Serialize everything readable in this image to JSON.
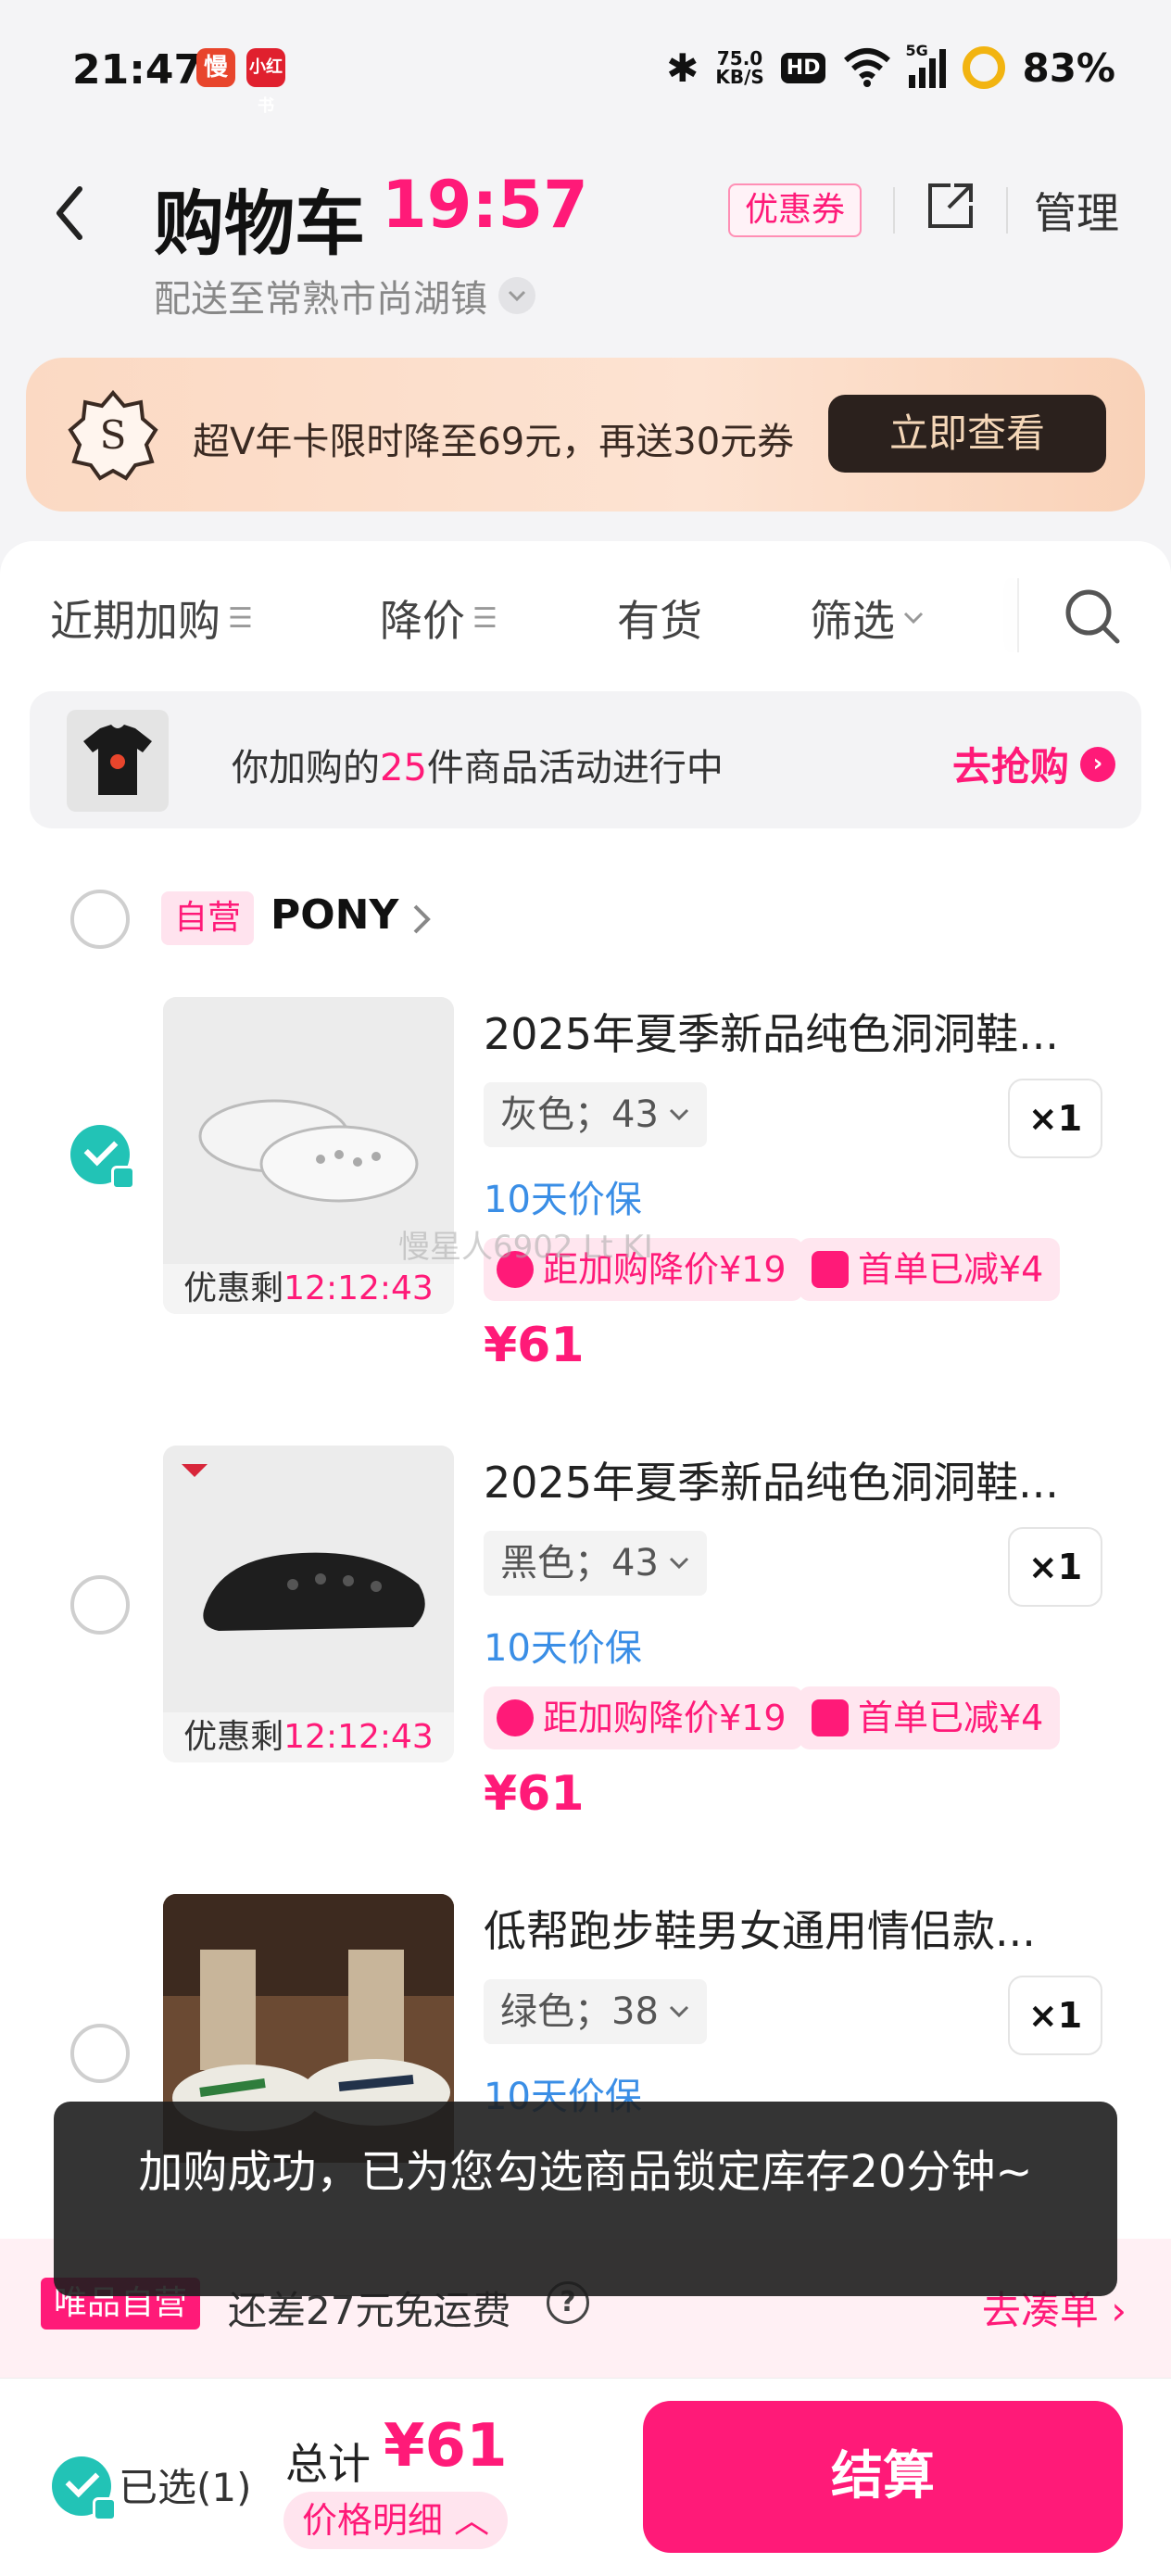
{
  "status_bar": {
    "time": "21:47",
    "app_icon_1": "慢",
    "app_icon_2": "小红书",
    "net_speed_value": "75.0",
    "net_speed_unit": "KB/S",
    "hd": "HD",
    "signal": "5G",
    "battery": "83%"
  },
  "header": {
    "title": "购物车",
    "timer": "19:57",
    "address": "配送至常熟市尚湖镇",
    "coupon_label": "优惠券",
    "manage_label": "管理"
  },
  "promo": {
    "badge_letter": "S",
    "text": "超V年卡限时降至69元，再送30元券",
    "button": "立即查看"
  },
  "filters": {
    "recent": "近期加购",
    "price_drop": "降价",
    "in_stock": "有货",
    "filter": "筛选"
  },
  "activity": {
    "text_prefix": "你加购的",
    "count": "25",
    "text_suffix": "件商品活动进行中",
    "link": "去抢购"
  },
  "store": {
    "tag": "自营",
    "name": "PONY"
  },
  "items": [
    {
      "title": "2025年夏季新品纯色洞洞鞋...",
      "variant": "灰色；43",
      "qty": "×1",
      "warranty": "10天价保",
      "tag1": "距加购降价¥19",
      "tag2": "首单已减¥4",
      "price": "¥61",
      "countdown_label": "优惠剩",
      "countdown": "12:12:43",
      "checked": true,
      "colors": {
        "shoe": "#f2f2f2"
      }
    },
    {
      "title": "2025年夏季新品纯色洞洞鞋...",
      "variant": "黑色；43",
      "qty": "×1",
      "warranty": "10天价保",
      "tag1": "距加购降价¥19",
      "tag2": "首单已减¥4",
      "price": "¥61",
      "countdown_label": "优惠剩",
      "countdown": "12:12:43",
      "checked": false,
      "colors": {
        "shoe": "#1e1e1e"
      }
    },
    {
      "title": "低帮跑步鞋男女通用情侣款...",
      "variant": "绿色；38",
      "qty": "×1",
      "warranty": "10天价保",
      "checked": false
    }
  ],
  "watermark": "慢星人6902 Lt KI",
  "shipping": {
    "tag": "唯品自营",
    "text": "还差27元免运费",
    "help": "?",
    "link": "去凑单"
  },
  "toast": "加购成功，已为您勾选商品锁定库存20分钟~",
  "bottom": {
    "selected": "已选(1)",
    "total_label": "总计",
    "total": "¥61",
    "detail": "价格明细",
    "checkout": "结算"
  },
  "colors": {
    "accent": "#ff1a78",
    "check": "#22c3b6",
    "link_blue": "#3a8ee6"
  }
}
